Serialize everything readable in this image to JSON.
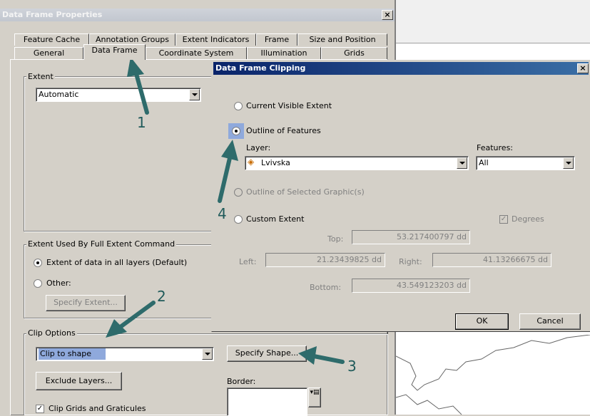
{
  "props_window": {
    "title": "Data Frame Properties",
    "close": "×",
    "tabs_row1": [
      "Feature Cache",
      "Annotation Groups",
      "Extent Indicators",
      "Frame",
      "Size and Position"
    ],
    "tabs_row2": [
      "General",
      "Data Frame",
      "Coordinate System",
      "Illumination",
      "Grids"
    ],
    "extent_group": "Extent",
    "extent_value": "Automatic",
    "full_extent_group": "Extent Used By Full Extent Command",
    "radio_all_layers": "Extent of data in all layers (Default)",
    "radio_other": "Other:",
    "specify_extent_btn": "Specify Extent...",
    "clip_group": "Clip Options",
    "clip_value": "Clip to shape",
    "specify_shape_btn": "Specify Shape...",
    "exclude_layers_btn": "Exclude Layers...",
    "border_label": "Border:",
    "clip_grids_label": "Clip Grids and Graticules"
  },
  "clip_dialog": {
    "title": "Data Frame Clipping",
    "close": "×",
    "opt_current": "Current Visible Extent",
    "opt_outline": "Outline of Features",
    "layer_label": "Layer:",
    "layer_value": "Lvivska",
    "features_label": "Features:",
    "features_value": "All",
    "opt_selected_graphics": "Outline of Selected Graphic(s)",
    "opt_custom": "Custom Extent",
    "degrees_label": "Degrees",
    "top_label": "Top:",
    "top_value": "53.217400797 dd",
    "left_label": "Left:",
    "left_value": "21.23439825 dd",
    "right_label": "Right:",
    "right_value": "41.13266675 dd",
    "bottom_label": "Bottom:",
    "bottom_value": "43.549123203 dd",
    "ok": "OK",
    "cancel": "Cancel"
  },
  "annotations": [
    "1",
    "2",
    "3",
    "4"
  ],
  "colors": {
    "arrow": "#2e6b6b",
    "title_active": "#0a246a",
    "title_inactive": "#c2c7cf",
    "selection": "#316ac5"
  }
}
